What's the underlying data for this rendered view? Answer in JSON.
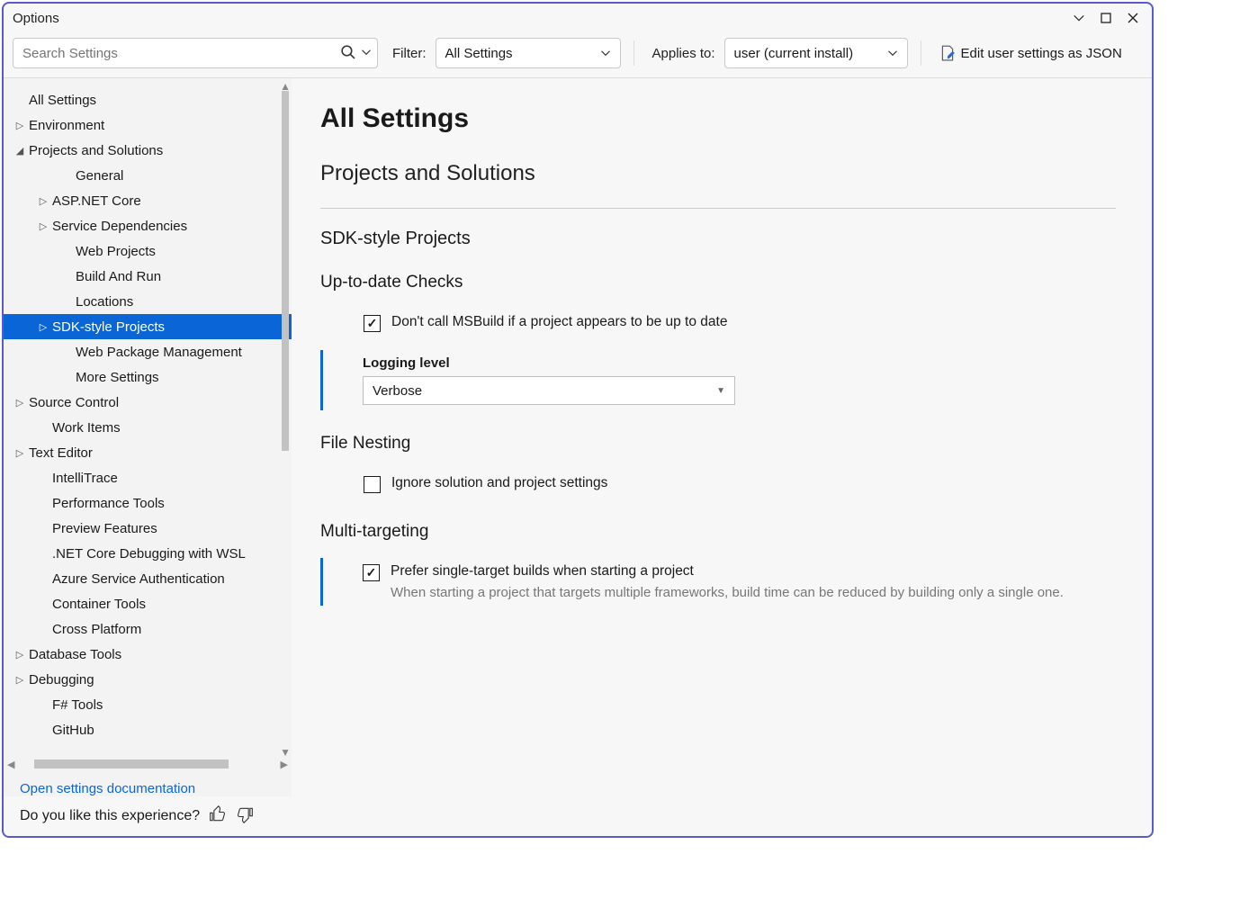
{
  "window": {
    "title": "Options"
  },
  "toolbar": {
    "search_placeholder": "Search Settings",
    "filter_label": "Filter:",
    "filter_value": "All Settings",
    "scope_label": "Applies to:",
    "scope_value": "user (current install)",
    "json_link": "Edit user settings as JSON"
  },
  "sidebar": {
    "items": [
      {
        "label": "All Settings",
        "level": 0,
        "caret": ""
      },
      {
        "label": "Environment",
        "level": 0,
        "caret": "right"
      },
      {
        "label": "Projects and Solutions",
        "level": 0,
        "caret": "down"
      },
      {
        "label": "General",
        "level": 2,
        "caret": ""
      },
      {
        "label": "ASP.NET Core",
        "level": 1,
        "caret": "right"
      },
      {
        "label": "Service Dependencies",
        "level": 1,
        "caret": "right"
      },
      {
        "label": "Web Projects",
        "level": 2,
        "caret": ""
      },
      {
        "label": "Build And Run",
        "level": 2,
        "caret": ""
      },
      {
        "label": "Locations",
        "level": 2,
        "caret": ""
      },
      {
        "label": "SDK-style Projects",
        "level": 1,
        "caret": "right",
        "selected": true
      },
      {
        "label": "Web Package Management",
        "level": 2,
        "caret": ""
      },
      {
        "label": "More Settings",
        "level": 2,
        "caret": ""
      },
      {
        "label": "Source Control",
        "level": 0,
        "caret": "right"
      },
      {
        "label": "Work Items",
        "level": 1,
        "caret": "",
        "indentOverride": 54
      },
      {
        "label": "Text Editor",
        "level": 0,
        "caret": "right"
      },
      {
        "label": "IntelliTrace",
        "level": 1,
        "caret": "",
        "indentOverride": 54
      },
      {
        "label": "Performance Tools",
        "level": 1,
        "caret": "",
        "indentOverride": 54
      },
      {
        "label": "Preview Features",
        "level": 1,
        "caret": "",
        "indentOverride": 54
      },
      {
        "label": ".NET Core Debugging with WSL",
        "level": 1,
        "caret": "",
        "indentOverride": 54
      },
      {
        "label": "Azure Service Authentication",
        "level": 1,
        "caret": "",
        "indentOverride": 54
      },
      {
        "label": "Container Tools",
        "level": 1,
        "caret": "",
        "indentOverride": 54
      },
      {
        "label": "Cross Platform",
        "level": 1,
        "caret": "",
        "indentOverride": 54
      },
      {
        "label": "Database Tools",
        "level": 0,
        "caret": "right"
      },
      {
        "label": "Debugging",
        "level": 0,
        "caret": "right"
      },
      {
        "label": "F# Tools",
        "level": 1,
        "caret": "",
        "indentOverride": 54
      },
      {
        "label": "GitHub",
        "level": 1,
        "caret": "",
        "indentOverride": 54
      }
    ],
    "doc_link": "Open settings documentation"
  },
  "content": {
    "page_title": "All Settings",
    "section": "Projects and Solutions",
    "subsection": "SDK-style Projects",
    "group1": {
      "title": "Up-to-date Checks",
      "check1_label": "Don't call MSBuild if a project appears to be up to date",
      "check1_checked": true,
      "logging_label": "Logging level",
      "logging_value": "Verbose"
    },
    "group2": {
      "title": "File Nesting",
      "check1_label": "Ignore solution and project settings",
      "check1_checked": false
    },
    "group3": {
      "title": "Multi-targeting",
      "check1_label": "Prefer single-target builds when starting a project",
      "check1_checked": true,
      "check1_desc": "When starting a project that targets multiple frameworks, build time can be reduced by building only a single one."
    }
  },
  "statusbar": {
    "feedback": "Do you like this experience?"
  }
}
